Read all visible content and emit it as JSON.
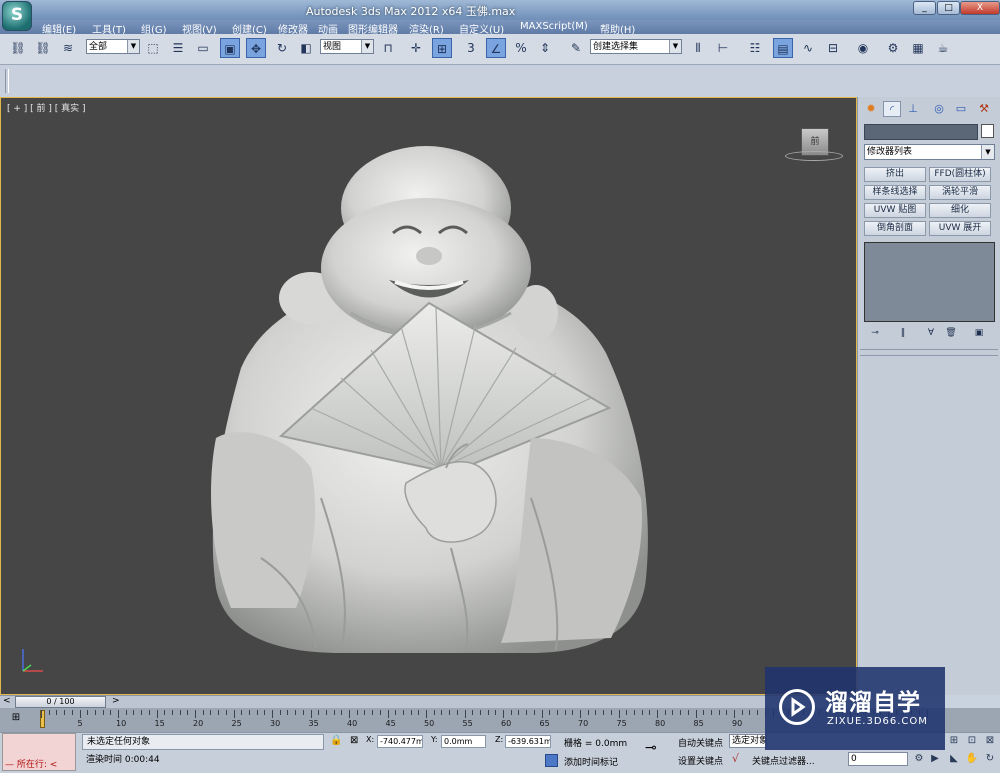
{
  "window": {
    "logo_letter": "S",
    "title": "Autodesk 3ds Max  2012 x64      玉佛.max",
    "min": "_",
    "max": "□",
    "close": "X"
  },
  "menu": [
    "编辑(E)",
    "工具(T)",
    "组(G)",
    "视图(V)",
    "创建(C)",
    "修改器",
    "动画",
    "图形编辑器",
    "渲染(R)",
    "自定义(U)",
    "MAXScript(M)",
    "帮助(H)"
  ],
  "toolbar": {
    "selection_filter": "全部",
    "ref_coord": "视图",
    "snap_3": "3",
    "named_selection": "创建选择集"
  },
  "viewport": {
    "label": "[ + ] [ 前 ] [ 真实 ]",
    "viewcube_face": "前",
    "statue_subject": "laughing Buddha statue with fan"
  },
  "command_panel": {
    "modifier_list": "修改器列表",
    "modifier_buttons": [
      "挤出",
      "FFD(圆柱体)",
      "样条线选择",
      "涡轮平滑",
      "UVW 贴图",
      "细化",
      "倒角剖面",
      "UVW 展开"
    ]
  },
  "timeline": {
    "frame_display": "0 / 100",
    "prev": "<",
    "next": ">",
    "ticks": [
      "0",
      "5",
      "10",
      "15",
      "20",
      "25",
      "30",
      "35",
      "40",
      "45",
      "50",
      "55",
      "60",
      "65",
      "70",
      "75",
      "80",
      "85",
      "90"
    ]
  },
  "status": {
    "maxscript_label": "所在行:",
    "selection_status": "未选定任何对象",
    "render_time_label": "渲染时间",
    "render_time": "0:00:44",
    "x_label": "X:",
    "x_value": "-740.477m",
    "y_label": "Y:",
    "y_value": "0.0mm",
    "z_label": "Z:",
    "z_value": "-639.631m",
    "grid": "栅格 = 0.0mm",
    "add_time_tag": "添加时间标记",
    "auto_key": "自动关键点",
    "selected_object": "选定对象",
    "set_key": "设置关键点",
    "key_filters": "关键点过滤器...",
    "current_frame": "0"
  },
  "watermark": {
    "name": "溜溜自学",
    "url": "ZIXUE.3D66.COM"
  },
  "colors": {
    "viewport_bg": "#464646",
    "active_border": "#e2b84a",
    "titlebar": "#6f8fb8",
    "watermark_bg": "#20346e"
  }
}
